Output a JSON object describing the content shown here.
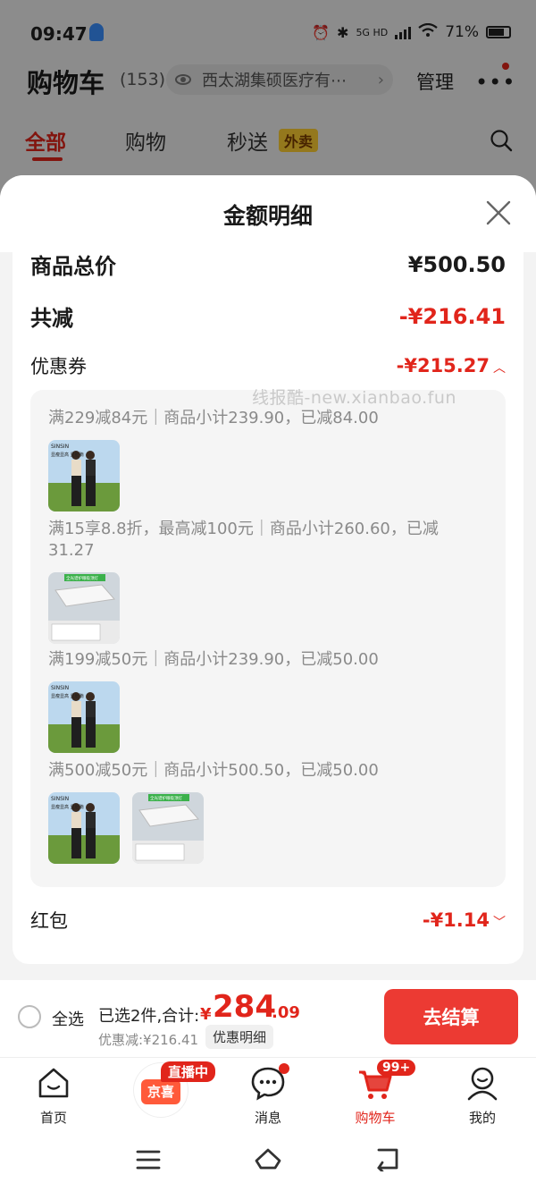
{
  "status_bar": {
    "time": "09:47",
    "network": "5G HD",
    "battery": "71%"
  },
  "header": {
    "title": "购物车",
    "count": "(153)",
    "store": "西太湖集硕医疗有⋯",
    "manage": "管理"
  },
  "tabs": [
    {
      "label": "全部"
    },
    {
      "label": "购物"
    },
    {
      "label": "秒送"
    }
  ],
  "takeout_badge": "外卖",
  "sheet": {
    "title": "金额明细",
    "total_label": "商品总价",
    "total_value": "¥500.50",
    "reduce_label": "共减",
    "reduce_value": "-¥216.41",
    "coupon_label": "优惠券",
    "coupon_value": "-¥215.27",
    "watermark": "线报酷-new.xianbao.fun",
    "coupon_lines": [
      "满229减84元｜商品小计239.90，已减84.00",
      "满15享8.8折，最高减100元｜商品小计260.60，已减31.27",
      "满199减50元｜商品小计239.90，已减50.00",
      "满500减50元｜商品小计500.50，已减50.00"
    ],
    "product_texts": {
      "brand": "SINSIN",
      "tagline": "显瘦显高 显肚腩",
      "lamp_tag": "全光谱护眼吸顶灯"
    },
    "redpacket_label": "红包",
    "redpacket_value": "-¥1.14"
  },
  "checkout": {
    "select_all": "全选",
    "summary_prefix": "已选2件,合计:",
    "yen": "¥",
    "amount_int": "284",
    "amount_dec": ".09",
    "discount": "优惠减:¥216.41",
    "detail": "优惠明细",
    "button": "去结算"
  },
  "tabbar": {
    "home": "首页",
    "jingxi": "京喜",
    "live": "直播中",
    "messages": "消息",
    "cart": "购物车",
    "cart_badge": "99+",
    "me": "我的"
  },
  "colors": {
    "accent": "#e1251b",
    "checkout": "#ec3a33",
    "takeout": "#ffcf33"
  }
}
